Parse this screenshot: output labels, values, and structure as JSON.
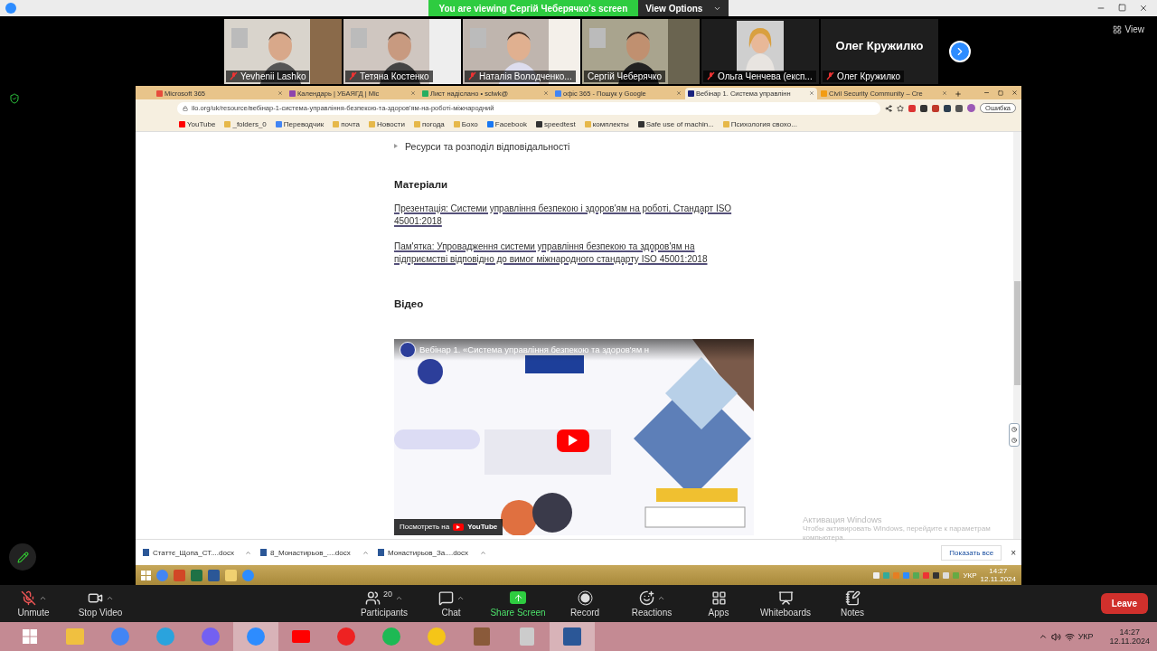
{
  "zoom_top": {
    "banner": "You are viewing Сергій Чеберячко's screen",
    "view_options": "View Options"
  },
  "view_button": "View",
  "gallery": [
    {
      "kind": "video",
      "name": "Yevhenii Lashko",
      "muted": true
    },
    {
      "kind": "video",
      "name": "Тетяна Костенко",
      "muted": true
    },
    {
      "kind": "video",
      "name": "Наталія Володченко...",
      "muted": true
    },
    {
      "kind": "video",
      "name": "Сергій Чеберячко",
      "muted": false
    },
    {
      "name": "Ольга Ченчева (експ...",
      "muted": true
    },
    {
      "kind": "name_only",
      "display_name": "Олег Кружилко",
      "name": "Олег Кружилко",
      "muted": true
    }
  ],
  "browser": {
    "tabs": [
      {
        "title": "Microsoft 365",
        "selected": false
      },
      {
        "title": "Календарь | УБАЯГД | Mic",
        "selected": false
      },
      {
        "title": "Лист надіслано • sclwk@",
        "selected": false
      },
      {
        "title": "офіс 365 - Пошук у Google",
        "selected": false
      },
      {
        "title": "Вебінар 1. Система управлінн",
        "selected": true
      },
      {
        "title": "Civil Security Community – Cre",
        "selected": false
      }
    ],
    "url": "ilo.org/uk/resource/вебінар-1-система-управління-безпекою-та-здоров'ям-на-роботі-міжнародний",
    "profile_button": "Ошибка",
    "bookmarks": [
      "YouTube",
      "_folders_0",
      "Переводчик",
      "почта",
      "Новости",
      "погода",
      "Бохо",
      "Facebook",
      "speedtest",
      "комплекты",
      "Safe use of machin...",
      "Психология свохо..."
    ]
  },
  "page": {
    "list_item": "Ресурси та розподіл відповідальності",
    "materials_heading": "Матеріали",
    "links": [
      "Презентація: Системи управління безпекою і здоров'ям на роботі, Стандарт ISO 45001:2018",
      "Пам'ятка: Упровадження системи управління безпекою та здоров'ям на підприємстві відповідно до вимог міжнародного стандарту ISO 45001:2018"
    ],
    "video_heading": "Відео",
    "video": {
      "kind": "picture",
      "title": "Вебінар 1. «Система управління безпекою та здоров'ям н",
      "watch_label": "Посмотреть на",
      "watch_brand": "YouTube"
    }
  },
  "activation": {
    "title": "Активация Windows",
    "text": "Чтобы активировать Windows, перейдите к параметрам компьютера."
  },
  "downloads": {
    "files": [
      "Статтє_Щопа_СТ....docx",
      "8_Монастирьов_....docx",
      "Монастирьов_За....docx"
    ],
    "show_all": "Показать все",
    "close": "×"
  },
  "inner_taskbar": {
    "language": "УКР",
    "time": "14:27",
    "date": "12.11.2024"
  },
  "toolbar_left": [
    {
      "kind": "mic_off",
      "label": "Unmute",
      "caret": true
    },
    {
      "kind": "video",
      "label": "Stop Video",
      "caret": true
    }
  ],
  "toolbar_center": [
    {
      "kind": "participants",
      "label": "Participants",
      "count": "20",
      "caret": true
    },
    {
      "kind": "chat",
      "label": "Chat",
      "caret": true
    },
    {
      "kind": "share",
      "label": "Share Screen",
      "caret": false
    },
    {
      "kind": "record",
      "label": "Record",
      "caret": false
    },
    {
      "kind": "reactions",
      "label": "Reactions",
      "caret": true
    },
    {
      "kind": "apps",
      "label": "Apps",
      "caret": false
    },
    {
      "kind": "whiteboards",
      "label": "Whiteboards",
      "caret": false
    },
    {
      "kind": "notes",
      "label": "Notes",
      "caret": false
    }
  ],
  "leave": "Leave",
  "taskbar": {
    "language": "УКР",
    "time": "14:27",
    "date": "12.11.2024"
  }
}
